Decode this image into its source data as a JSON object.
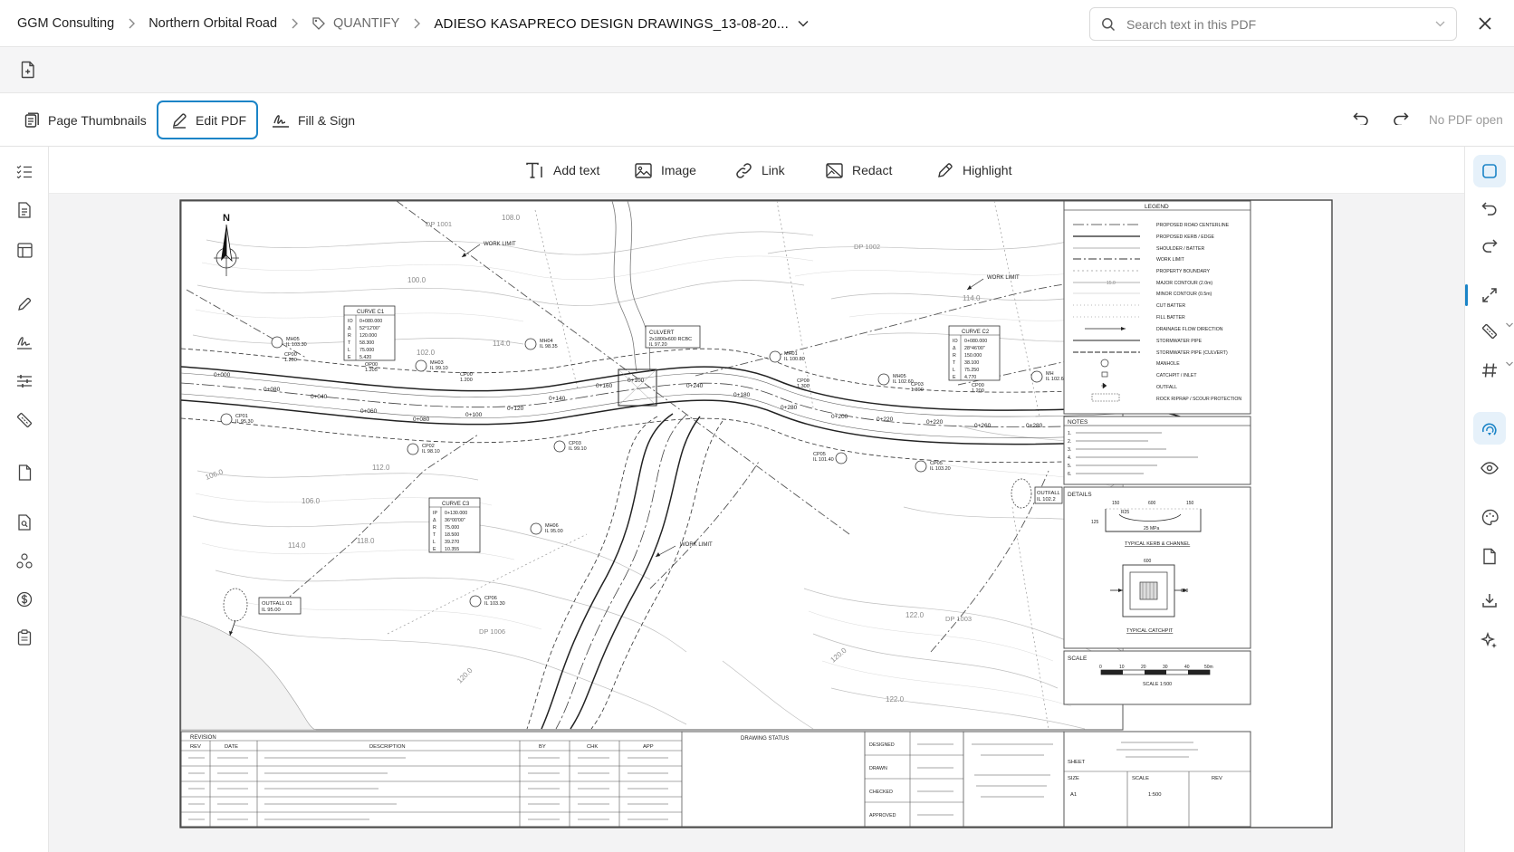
{
  "breadcrumb": {
    "org": "GGM Consulting",
    "project": "Northern Orbital Road",
    "module": "QUANTIFY",
    "document": "ADIESO KASAPRECO DESIGN DRAWINGS_13-08-20..."
  },
  "search": {
    "placeholder": "Search text in this PDF"
  },
  "toolbar": {
    "page_thumbnails": "Page Thumbnails",
    "edit_pdf": "Edit PDF",
    "fill_sign": "Fill & Sign",
    "status": "No PDF open"
  },
  "edit_tools": {
    "add_text": "Add text",
    "image": "Image",
    "link": "Link",
    "redact": "Redact",
    "highlight": "Highlight"
  },
  "drawing": {
    "north": "N",
    "legend_title": "LEGEND",
    "legend": [
      "PROPOSED ROAD CENTERLINE",
      "PROPOSED KERB / EDGE",
      "SHOULDER / BATTER",
      "WORK LIMIT",
      "PROPERTY BOUNDARY",
      "MAJOR CONTOUR (2.0m)",
      "MINOR CONTOUR (0.5m)",
      "CUT BATTER",
      "FILL BATTER",
      "DRAINAGE FLOW DIRECTION",
      "STORMWATER PIPE",
      "STORMWATER PIPE (CULVERT)",
      "MANHOLE",
      "CATCHPIT / INLET",
      "OUTFALL",
      "ROCK RIPRAP / SCOUR PROTECTION"
    ],
    "legend_contour_value": "15.0",
    "notes_title": "NOTES",
    "note_numbers": [
      "1.",
      "2.",
      "3.",
      "4.",
      "5.",
      "6."
    ],
    "details_title": "DETAILS",
    "kerb_caption": "TYPICAL KERB & CHANNEL",
    "kerb_dims": [
      "150",
      "600",
      "150",
      "R25",
      "125",
      "25 MPa"
    ],
    "catchpit_caption": "TYPICAL CATCHPIT",
    "catchpit_dims": [
      "600",
      "600"
    ],
    "scale_title": "SCALE",
    "scale_ticks": [
      "0",
      "10",
      "20",
      "30",
      "40",
      "50m"
    ],
    "scale_text": "SCALE 1:500",
    "revision_title": "REVISION",
    "revision_headers": [
      "REV",
      "DATE",
      "DESCRIPTION",
      "BY",
      "CHK",
      "APP"
    ],
    "drawing_status": "DRAWING STATUS",
    "signoff": [
      "DESIGNED",
      "DRAWN",
      "CHECKED",
      "APPROVED"
    ],
    "sheet_label": "SHEET",
    "size_label": "SIZE",
    "size_value": "A1",
    "scale_label": "SCALE",
    "scale_value": "1:500",
    "rev_label": "REV",
    "curve_c1": {
      "title": "CURVE C1",
      "rows": [
        [
          "IO",
          "0+080.000"
        ],
        [
          "Δ",
          "52°12'00\""
        ],
        [
          "R",
          "120.000"
        ],
        [
          "T",
          "58.300"
        ],
        [
          "L",
          "75.000"
        ],
        [
          "E",
          "5.420"
        ]
      ]
    },
    "curve_c2": {
      "title": "CURVE C2",
      "rows": [
        [
          "IO",
          "0+080.000"
        ],
        [
          "Δ",
          "28°46'00\""
        ],
        [
          "R",
          "150.000"
        ],
        [
          "T",
          "38.100"
        ],
        [
          "L",
          "75.250"
        ],
        [
          "E",
          "4.770"
        ]
      ]
    },
    "curve_c3": {
      "title": "CURVE C3",
      "rows": [
        [
          "IP",
          "0+130.000"
        ],
        [
          "Δ",
          "36°00'00\""
        ],
        [
          "R",
          "75.000"
        ],
        [
          "T",
          "18.500"
        ],
        [
          "L",
          "39.270"
        ],
        [
          "E",
          "10.355"
        ]
      ]
    },
    "culvert": [
      "CULVERT",
      "2x1800x600 RCBC",
      "IL 97.20"
    ],
    "outfall1": [
      "OUTFALL 01",
      "IL 95.00"
    ],
    "outfall2": [
      "OUTFALL",
      "IL 102.2"
    ],
    "work_limit": "WORK LIMIT",
    "dps": [
      "DP 1001",
      "DP 1002",
      "DP 1003",
      "DP 1006"
    ],
    "contours": [
      "100.0",
      "102.0",
      "104.0",
      "106.0",
      "108.0",
      "110.0",
      "112.0",
      "114.0",
      "116.0",
      "118.0",
      "120.0",
      "122.0",
      "11"
    ],
    "chainages": [
      "0+000",
      "0+020",
      "0+040",
      "0+060",
      "0+080",
      "0+100",
      "0+120",
      "0+140",
      "0+160",
      "0+180",
      "0+200",
      "0+220",
      "0+240",
      "0+260",
      "0+280"
    ],
    "structures": [
      [
        "MH05",
        "IL 103.30"
      ],
      [
        "MH03",
        "IL 99.10"
      ],
      [
        "MH04",
        "IL 98.35"
      ],
      [
        "MH01",
        "IL 100.80"
      ],
      [
        "MH05",
        "IL 102.60"
      ],
      [
        "MH",
        "IL 102.6"
      ],
      [
        "CP01",
        "IL 95.30"
      ],
      [
        "CP02",
        "IL 98.10"
      ],
      [
        "CP03",
        "IL 99.10"
      ],
      [
        "CP05",
        "IL 101.40"
      ],
      [
        "CP05",
        "IL 103.20"
      ],
      [
        "MH06",
        "IL 95.00"
      ],
      [
        "CP06",
        "IL 103.30"
      ],
      [
        "CP00",
        "1.200"
      ],
      [
        "OP00",
        "1.205"
      ],
      [
        "CP00",
        "1.200"
      ],
      [
        "CP00",
        "1.300"
      ],
      [
        "CP03",
        "1.300"
      ],
      [
        "CP00",
        "1.200"
      ]
    ]
  }
}
